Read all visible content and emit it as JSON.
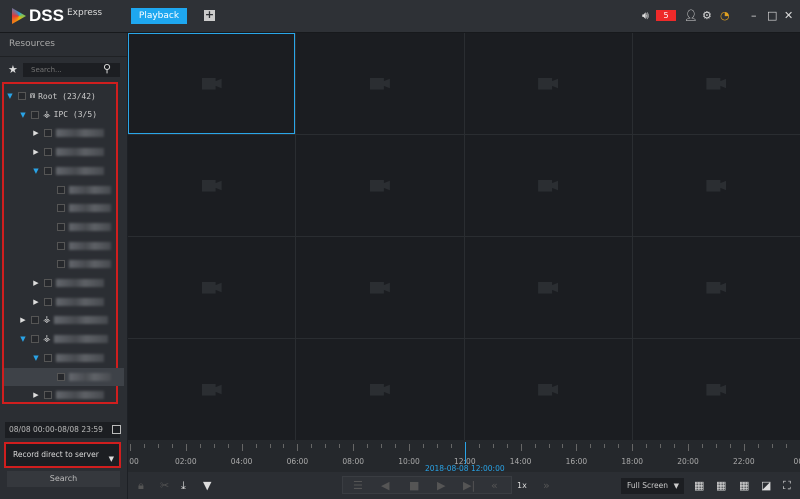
{
  "app": {
    "name": "DSS",
    "subtitle": "Express"
  },
  "tabs": [
    {
      "label": "Playback",
      "active": true
    }
  ],
  "add_tab_icon": "plus-icon",
  "header": {
    "alarm_count": "5",
    "icons": [
      "volume-icon",
      "user-icon",
      "gear-icon",
      "performance-gauge-icon",
      "minimize-icon",
      "maximize-icon",
      "close-icon"
    ]
  },
  "sidebar": {
    "title": "Resources",
    "search_placeholder": "Search...",
    "tree": [
      {
        "label": "Root (23/42)",
        "level": 0,
        "state": "open",
        "icon": "root-icon"
      },
      {
        "label": "IPC (3/5)",
        "level": 1,
        "state": "open",
        "icon": "org-icon"
      },
      {
        "label": "",
        "level": 2,
        "state": "closed",
        "blurred": true
      },
      {
        "label": "",
        "level": 2,
        "state": "closed",
        "blurred": true
      },
      {
        "label": "",
        "level": 2,
        "state": "open",
        "blurred": true
      },
      {
        "label": "",
        "level": 3,
        "state": "none",
        "blurred": true
      },
      {
        "label": "",
        "level": 3,
        "state": "none",
        "blurred": true
      },
      {
        "label": "",
        "level": 3,
        "state": "none",
        "blurred": true
      },
      {
        "label": "",
        "level": 3,
        "state": "none",
        "blurred": true
      },
      {
        "label": "",
        "level": 3,
        "state": "none",
        "blurred": true
      },
      {
        "label": "",
        "level": 2,
        "state": "closed",
        "blurred": true
      },
      {
        "label": "",
        "level": 2,
        "state": "closed",
        "blurred": true
      },
      {
        "label": "",
        "level": 1,
        "state": "closed",
        "icon": "org-icon",
        "blurred": true
      },
      {
        "label": "",
        "level": 1,
        "state": "open",
        "icon": "org-icon",
        "blurred": true
      },
      {
        "label": "",
        "level": 2,
        "state": "open",
        "blurred": true
      },
      {
        "label": "",
        "level": 3,
        "state": "none",
        "blurred": true,
        "selected": true
      },
      {
        "label": "",
        "level": 2,
        "state": "closed",
        "blurred": true
      }
    ],
    "date_range": "08/08 00:00-08/08 23:59",
    "record_type": "Record direct to server",
    "search_button": "Search"
  },
  "timeline": {
    "labels": [
      "00",
      "02:00",
      "04:00",
      "06:00",
      "08:00",
      "10:00",
      "12:00",
      "14:00",
      "16:00",
      "18:00",
      "20:00",
      "22:00",
      "00:"
    ],
    "cursor_hour": 12,
    "cursor_label": "2018-08-08 12:00:00"
  },
  "playback": {
    "speed": "1x",
    "window_mode": "Full Screen"
  }
}
